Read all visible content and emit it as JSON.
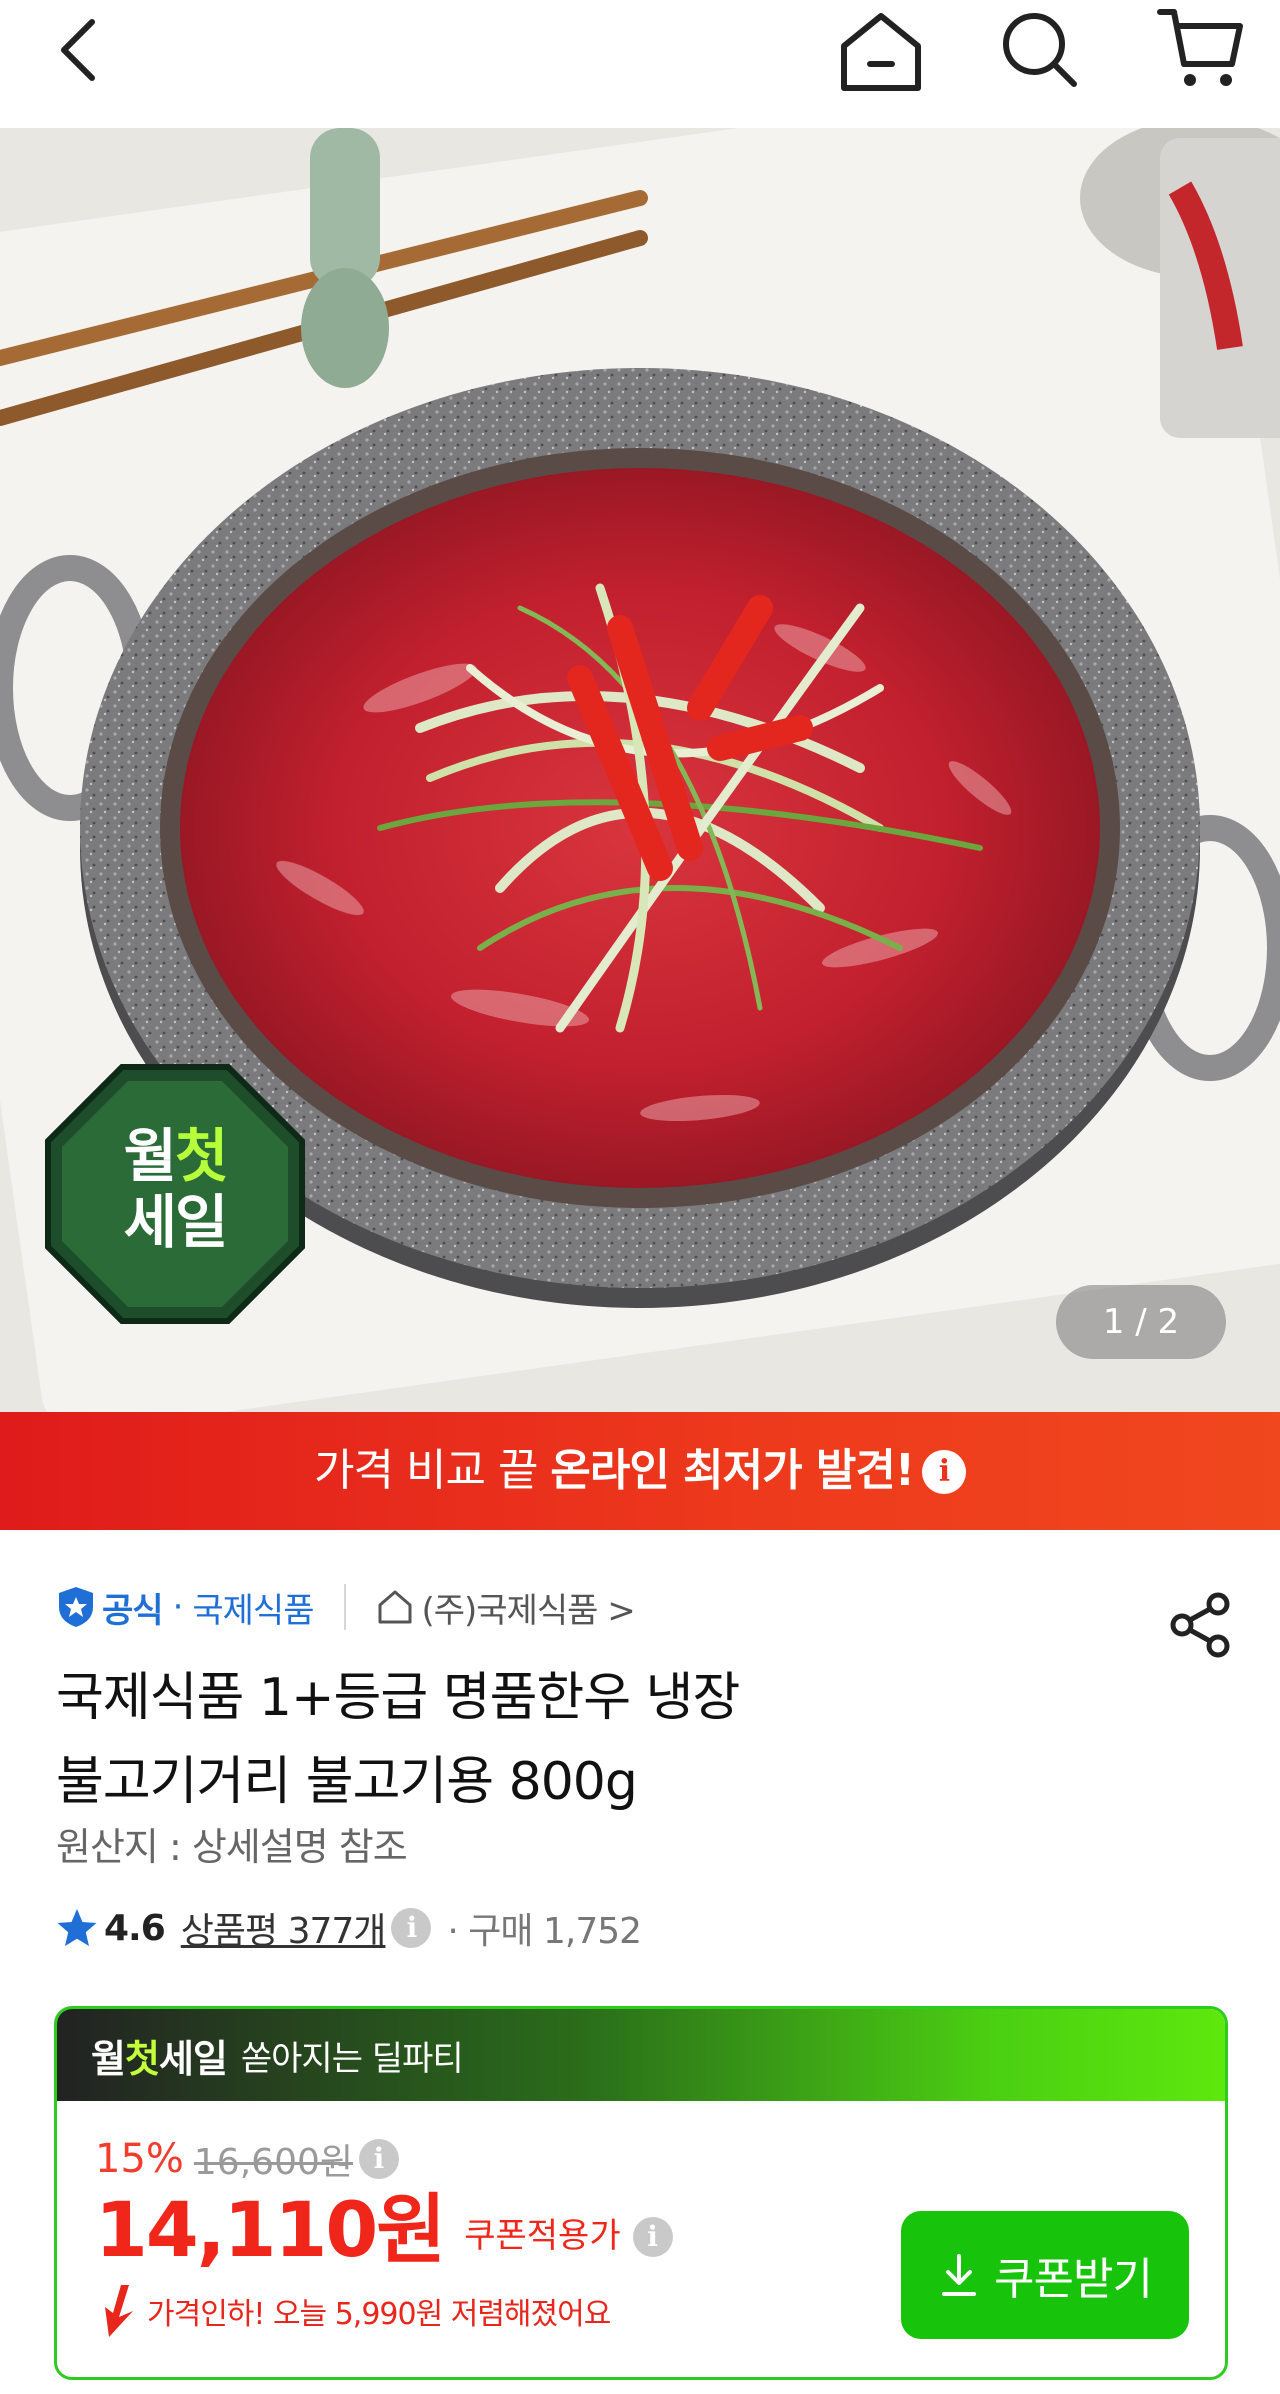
{
  "topbar": {
    "icons": [
      "back-icon",
      "home-icon",
      "search-icon",
      "cart-icon"
    ]
  },
  "hero": {
    "badge_line1_a": "월",
    "badge_line1_b": "첫",
    "badge_line2": "세일",
    "pager": "1 / 2"
  },
  "banner": {
    "text_plain": "가격 비교 끝 ",
    "text_bold": "온라인 최저가 발견!",
    "info_icon": "i"
  },
  "seller": {
    "official": "공식",
    "separator": "·",
    "brand": "국제식품",
    "store": "(주)국제식품 >"
  },
  "product": {
    "title_line1": "국제식품 1+등급 명품한우 냉장",
    "title_line2": "불고기거리 불고기용 800g",
    "origin": "원산지 : 상세설명 참조"
  },
  "rating": {
    "score": "4.6",
    "review_label": "상품평 377개",
    "info_icon": "i",
    "purchase": "· 구매 1,752"
  },
  "price_card": {
    "logo_a": "월",
    "logo_b": "첫",
    "logo_c": "세일",
    "subtitle": "쏟아지는 딜파티",
    "discount_pct": "15%",
    "original_price": "16,600원",
    "price": "14,110원",
    "price_label": "쿠폰적용가",
    "price_drop": "가격인하! 오늘 5,990원 저렴해졌어요",
    "coupon_button": "쿠폰받기"
  },
  "colors": {
    "accent_red": "#f0261b",
    "official_blue": "#1f6fd6",
    "coupon_green": "#18c40b"
  }
}
